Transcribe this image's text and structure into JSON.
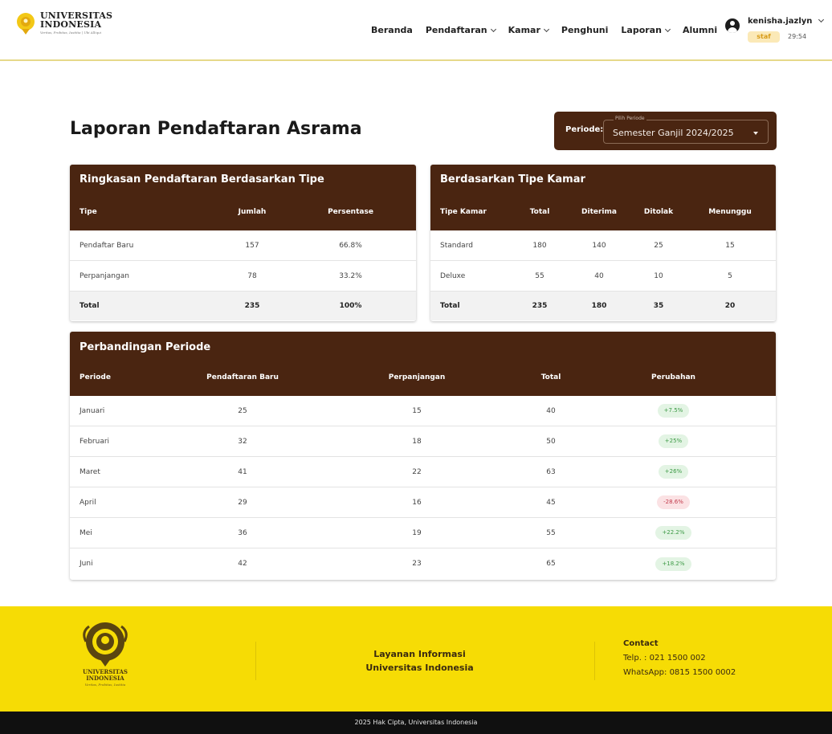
{
  "logo": {
    "line1": "UNIVERSITAS",
    "line2": "INDONESIA",
    "tagline": "Veritas, Probitas, Iustitia | Ubi Alliqui"
  },
  "nav": {
    "items": [
      {
        "label": "Beranda",
        "dropdown": false
      },
      {
        "label": "Pendaftaran",
        "dropdown": true
      },
      {
        "label": "Kamar",
        "dropdown": true
      },
      {
        "label": "Penghuni",
        "dropdown": false
      },
      {
        "label": "Laporan",
        "dropdown": true
      },
      {
        "label": "Alumni",
        "dropdown": false
      }
    ]
  },
  "user": {
    "name": "kenisha.jazlyn",
    "role": "staf",
    "timer": "29:54"
  },
  "page": {
    "title": "Laporan Pendaftaran Asrama"
  },
  "period": {
    "label": "Periode:",
    "float_label": "Pilih Periode",
    "value": "Semester Ganjil 2024/2025"
  },
  "summary": {
    "title": "Ringkasan Pendaftaran Berdasarkan Tipe",
    "headers": [
      "Tipe",
      "Jumlah",
      "Persentase"
    ],
    "rows": [
      [
        "Pendaftar Baru",
        "157",
        "66.8%"
      ],
      [
        "Perpanjangan",
        "78",
        "33.2%"
      ]
    ],
    "total": [
      "Total",
      "235",
      "100%"
    ]
  },
  "room_type": {
    "title": "Berdasarkan Tipe Kamar",
    "headers": [
      "Tipe Kamar",
      "Total",
      "Diterima",
      "Ditolak",
      "Menunggu"
    ],
    "rows": [
      [
        "Standard",
        "180",
        "140",
        "25",
        "15"
      ],
      [
        "Deluxe",
        "55",
        "40",
        "10",
        "5"
      ]
    ],
    "total": [
      "Total",
      "235",
      "180",
      "35",
      "20"
    ]
  },
  "comparison": {
    "title": "Perbandingan Periode",
    "headers": [
      "Periode",
      "Pendaftaran Baru",
      "Perpanjangan",
      "Total",
      "Perubahan"
    ],
    "rows": [
      {
        "period": "Januari",
        "new": "25",
        "renew": "15",
        "total": "40",
        "change": "+7.5%",
        "trend": "up"
      },
      {
        "period": "Februari",
        "new": "32",
        "renew": "18",
        "total": "50",
        "change": "+25%",
        "trend": "up"
      },
      {
        "period": "Maret",
        "new": "41",
        "renew": "22",
        "total": "63",
        "change": "+26%",
        "trend": "up"
      },
      {
        "period": "April",
        "new": "29",
        "renew": "16",
        "total": "45",
        "change": "-28.6%",
        "trend": "down"
      },
      {
        "period": "Mei",
        "new": "36",
        "renew": "19",
        "total": "55",
        "change": "+22.2%",
        "trend": "up"
      },
      {
        "period": "Juni",
        "new": "42",
        "renew": "23",
        "total": "65",
        "change": "+18.2%",
        "trend": "up"
      }
    ]
  },
  "footer": {
    "uni_line1": "UNIVERSITAS",
    "uni_line2": "INDONESIA",
    "uni_tagline": "Veritas, Probitas, Iustitia",
    "info_line1": "Layanan Informasi",
    "info_line2": "Universitas Indonesia",
    "contact_title": "Contact",
    "phone": "Telp. : 021 1500 002",
    "whatsapp": "WhatsApp: 0815 1500 0002",
    "copyright": "2025 Hak Cipta, Universitas Indonesia"
  },
  "colors": {
    "brand_brown": "#4a2511",
    "footer_yellow": "#f6dc05",
    "positive": "#3d9a46",
    "negative": "#c2394a",
    "role_badge": "#fbe9b7"
  },
  "icons": {
    "user": "user-circle-icon",
    "dropdown": "chevron-down-icon",
    "select": "caret-down-icon",
    "emblem": "makara-emblem-icon"
  }
}
